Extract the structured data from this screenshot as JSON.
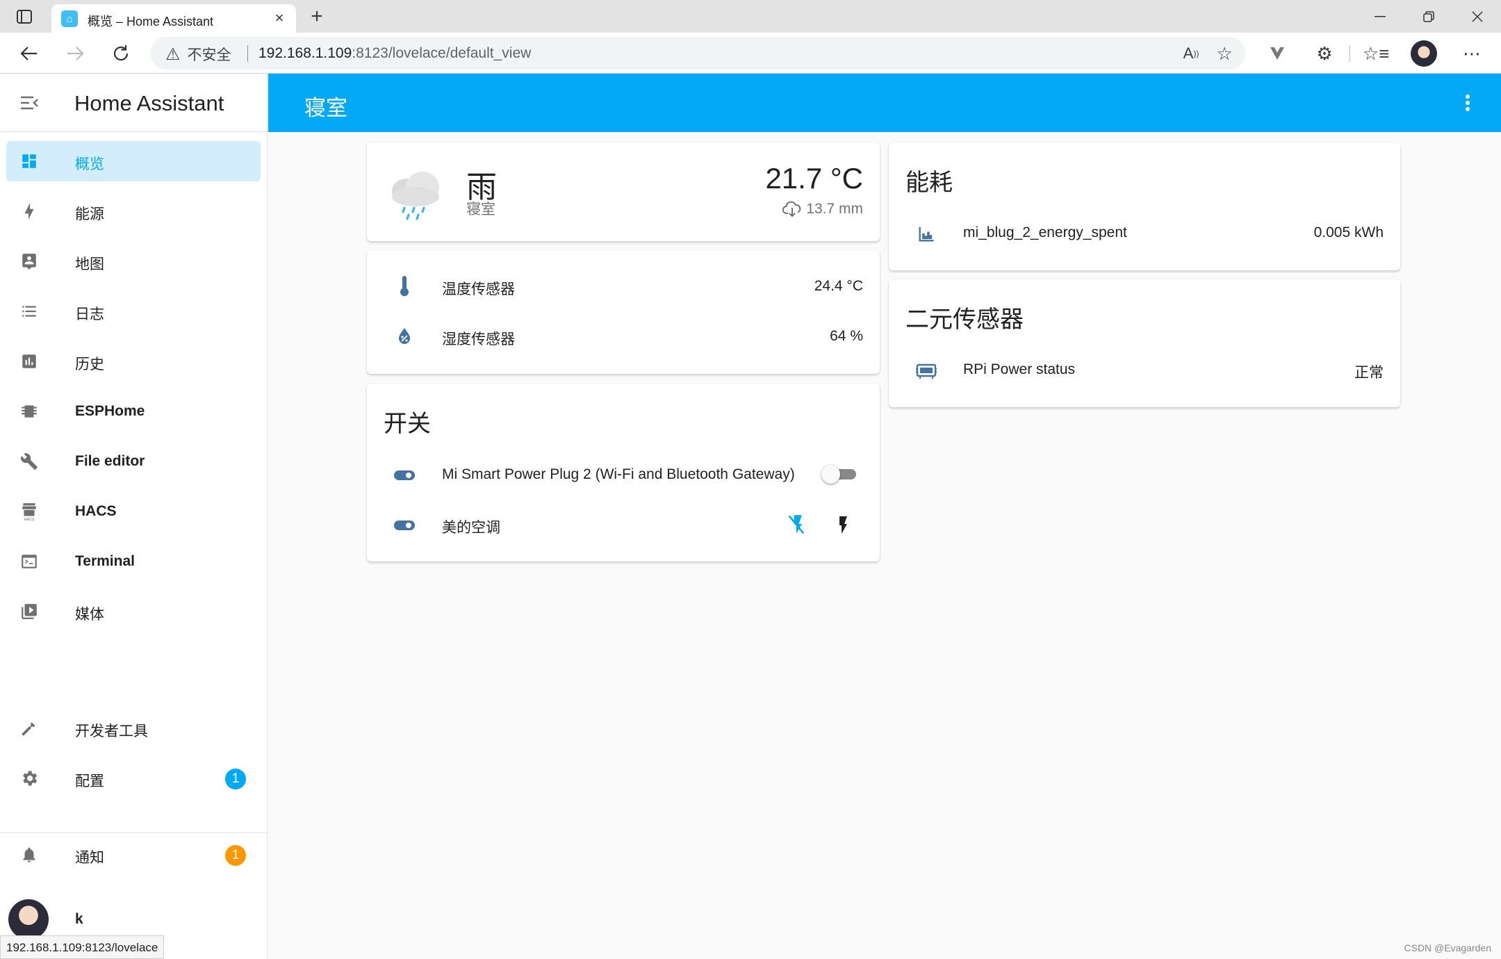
{
  "browser": {
    "tab_title": "概览 – Home Assistant",
    "security_label": "不安全",
    "url_host": "192.168.1.109",
    "url_rest": ":8123/lovelace/default_view",
    "status_url": "192.168.1.109:8123/lovelace"
  },
  "sidebar": {
    "title": "Home Assistant",
    "items": [
      {
        "label": "概览",
        "icon": "dashboard-icon"
      },
      {
        "label": "能源",
        "icon": "lightning-icon"
      },
      {
        "label": "地图",
        "icon": "map-account-icon"
      },
      {
        "label": "日志",
        "icon": "logbook-list-icon"
      },
      {
        "label": "历史",
        "icon": "history-chart-icon"
      },
      {
        "label": "ESPHome",
        "icon": "chip-icon"
      },
      {
        "label": "File editor",
        "icon": "wrench-icon"
      },
      {
        "label": "HACS",
        "icon": "hacs-icon"
      },
      {
        "label": "Terminal",
        "icon": "console-icon"
      },
      {
        "label": "媒体",
        "icon": "media-play-icon"
      }
    ],
    "dev_tools": {
      "label": "开发者工具",
      "icon": "hammer-icon"
    },
    "config": {
      "label": "配置",
      "badge": "1",
      "icon": "gear-icon"
    },
    "notifications": {
      "label": "通知",
      "badge": "1",
      "icon": "bell-icon"
    },
    "user": {
      "name": "k"
    }
  },
  "header": {
    "title": "寝室"
  },
  "weather": {
    "state": "雨",
    "name": "寝室",
    "temperature": "21.7 °C",
    "precipitation": "13.7 mm"
  },
  "sensors": [
    {
      "name": "温度传感器",
      "value": "24.4 °C",
      "icon": "thermometer-icon"
    },
    {
      "name": "湿度传感器",
      "value": "64 %",
      "icon": "water-percent-icon"
    }
  ],
  "switches": {
    "title": "开关",
    "items": [
      {
        "name": "Mi Smart Power Plug 2 (Wi-Fi and Bluetooth Gateway)",
        "state": "off"
      },
      {
        "name": "美的空调"
      }
    ]
  },
  "energy": {
    "title": "能耗",
    "rows": [
      {
        "name": "mi_blug_2_energy_spent",
        "value": "0.005 kWh"
      }
    ]
  },
  "binary": {
    "title": "二元传感器",
    "rows": [
      {
        "name": "RPi Power status",
        "value": "正常"
      }
    ]
  },
  "watermark": "CSDN @Evagarden",
  "colors": {
    "primary": "#03a9f4",
    "state_icon": "#44739e",
    "badge_config": "#03a9f4",
    "badge_notify": "#ff9800"
  }
}
